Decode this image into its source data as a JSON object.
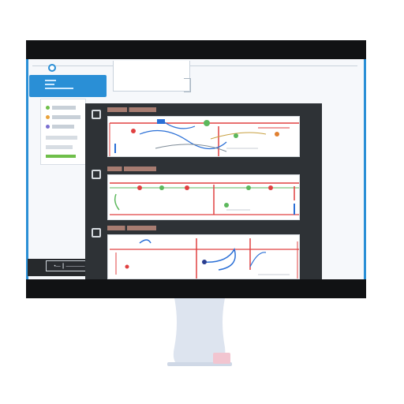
{
  "window": {
    "title": "",
    "bottom_label": "•— ┃ ――――"
  },
  "cards": [
    {
      "title": "",
      "has_checkbox": true
    },
    {
      "title": "",
      "has_checkbox": true
    },
    {
      "title": "",
      "has_checkbox": true
    }
  ],
  "colors": {
    "accent": "#2a8fd6",
    "panel": "#2e3236",
    "bezel": "#111214",
    "line_red": "#e04040",
    "line_blue": "#2a6fd6",
    "line_green": "#5cb85c",
    "stand": "#d7dfeb"
  },
  "icons": [
    "checkbox-icon",
    "logo-icon",
    "monitor-stand"
  ]
}
